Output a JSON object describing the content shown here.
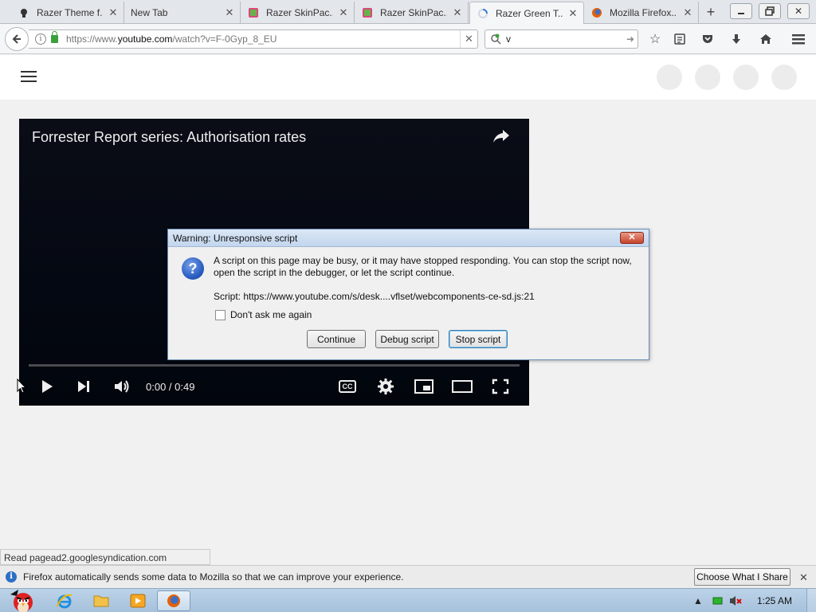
{
  "browser": {
    "tabs": [
      {
        "label": "Razer Theme f...",
        "favicon": "razer-icon",
        "active": false
      },
      {
        "label": "New Tab",
        "favicon": "",
        "active": false
      },
      {
        "label": "Razer SkinPac...",
        "favicon": "skinpack-icon",
        "active": false
      },
      {
        "label": "Razer SkinPac...",
        "favicon": "skinpack-icon",
        "active": false
      },
      {
        "label": "Razer Green T...",
        "favicon": "loading-spinner-icon",
        "active": true
      },
      {
        "label": "Mozilla Firefox...",
        "favicon": "firefox-icon",
        "active": false
      }
    ],
    "url": {
      "prefix": "https://www.",
      "domain": "youtube.com",
      "path": "/watch?v=F-0Gyp_8_EU"
    },
    "search_value": "v"
  },
  "page": {
    "video": {
      "title": "Forrester Report series: Authorisation rates",
      "time": "0:00 / 0:49",
      "progress": 0
    }
  },
  "dialog": {
    "title": "Warning: Unresponsive script",
    "message": "A script on this page may be busy, or it may have stopped responding. You can stop the script now, open the script in the debugger, or let the script continue.",
    "script_line": "Script: https://www.youtube.com/s/desk....vflset/webcomponents-ce-sd.js:21",
    "checkbox_label": "Don't ask me again",
    "checkbox_checked": false,
    "buttons": {
      "continue": "Continue",
      "debug": "Debug script",
      "stop": "Stop script"
    }
  },
  "status_text": "Read pagead2.googlesyndication.com",
  "notification": {
    "text": "Firefox automatically sends some data to Mozilla so that we can improve your experience.",
    "button": "Choose What I Share"
  },
  "taskbar": {
    "clock": "1:25 AM"
  }
}
